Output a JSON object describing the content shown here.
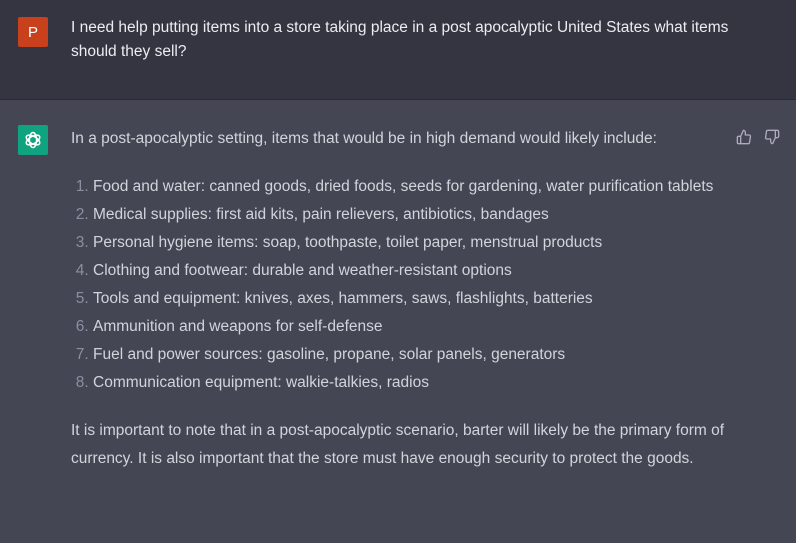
{
  "user_message": {
    "avatar_letter": "P",
    "avatar_color": "#c9401c",
    "text": "I need help putting items into a store taking place in a post apocalyptic United States what items should they sell?"
  },
  "assistant_message": {
    "avatar_icon": "openai-logo-icon",
    "avatar_color": "#10a37f",
    "intro": "In a post-apocalyptic setting, items that would be in high demand would likely include:",
    "items": [
      "Food and water: canned goods, dried foods, seeds for gardening, water purification tablets",
      "Medical supplies: first aid kits, pain relievers, antibiotics, bandages",
      "Personal hygiene items: soap, toothpaste, toilet paper, menstrual products",
      "Clothing and footwear: durable and weather-resistant options",
      "Tools and equipment: knives, axes, hammers, saws, flashlights, batteries",
      "Ammunition and weapons for self-defense",
      "Fuel and power sources: gasoline, propane, solar panels, generators",
      "Communication equipment: walkie-talkies, radios"
    ],
    "conclusion": "It is important to note that in a post-apocalyptic scenario, barter will likely be the primary form of currency. It is also important that the store must have enough security to protect the goods."
  },
  "feedback": {
    "thumbs_up_icon": "thumbs-up-icon",
    "thumbs_down_icon": "thumbs-down-icon"
  }
}
